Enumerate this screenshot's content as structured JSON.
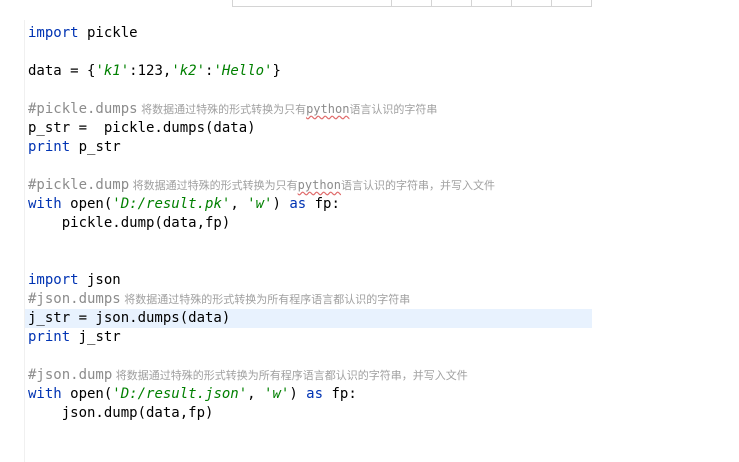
{
  "header": {
    "table_cells": [
      "",
      "",
      "",
      "",
      "",
      ""
    ]
  },
  "code": {
    "l1_kw": "import",
    "l1_mod": " pickle",
    "l3_var": "data = {",
    "l3_s1": "'k1'",
    "l3_colon1": ":",
    "l3_n1": "123",
    "l3_comma": ",",
    "l3_s2": "'k2'",
    "l3_colon2": ":",
    "l3_s3": "'Hello'",
    "l3_end": "}",
    "l5_comment": "#pickle.dumps",
    "l5_cjk_a": " 将数据通过特殊的形式转换为只有",
    "l5_typo": "python",
    "l5_cjk_b": "语言认识的字符串",
    "l6": "p_str =  pickle.dumps(data)",
    "l7_kw": "print",
    "l7_rest": " p_str",
    "l9_comment": "#pickle.dump",
    "l9_cjk_a": " 将数据通过特殊的形式转换为只有",
    "l9_typo": "python",
    "l9_cjk_b": "语言认识的字符串，并写入文件",
    "l10_kw": "with",
    "l10_a": " open(",
    "l10_s1": "'D:/result.pk'",
    "l10_b": ", ",
    "l10_s2": "'w'",
    "l10_c": ") ",
    "l10_kw2": "as",
    "l10_d": " fp:",
    "l11": "    pickle.dump(data,fp)",
    "l14_kw": "import",
    "l14_mod": " json",
    "l15_comment": "#json.dumps",
    "l15_cjk": " 将数据通过特殊的形式转换为所有程序语言都认识的字符串",
    "l16": "j_str = json.dumps(data)",
    "l17_kw": "print",
    "l17_rest": " j_str",
    "l19_comment": "#json.dump",
    "l19_cjk": " 将数据通过特殊的形式转换为所有程序语言都认识的字符串，并写入文件",
    "l20_kw": "with",
    "l20_a": " open(",
    "l20_s1": "'D:/result.json'",
    "l20_b": ", ",
    "l20_s2": "'w'",
    "l20_c": ") ",
    "l20_kw2": "as",
    "l20_d": " fp:",
    "l21": "    json.dump(data,fp)"
  },
  "colors": {
    "keyword": "#0033b3",
    "string": "#008000",
    "comment": "#8c8c8c",
    "current_line": "#e8f2fe"
  }
}
